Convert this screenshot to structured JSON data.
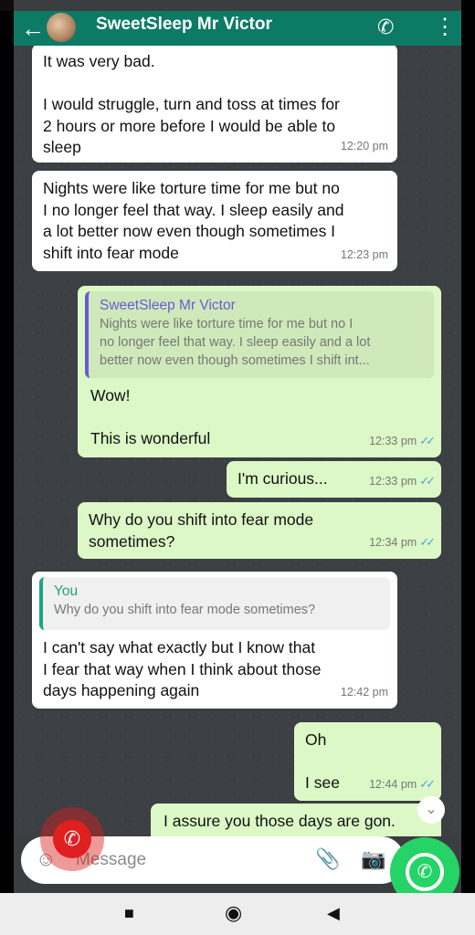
{
  "header": {
    "contact_name": "SweetSleep Mr Victor",
    "back_icon": "←",
    "add_call_icon": "✆"
  },
  "messages": [
    {
      "text": "It was very bad.\n\nI would struggle, turn and toss at times for\n2 hours or more before I would be able to\nsleep",
      "time": "12:20 pm"
    },
    {
      "text": "Nights were like torture time for me but no\nI no longer feel that way. I sleep easily and\na lot better now even though sometimes I\nshift into fear mode",
      "time": "12:23 pm"
    },
    {
      "quote_name": "SweetSleep Mr Victor",
      "quote_text": "Nights were like torture time for me but no I\nno longer feel that way. I sleep easily and a lot\nbetter now even though sometimes I shift int...",
      "text": "Wow!\n\nThis is wonderful",
      "time": "12:33 pm",
      "ticks": "✓✓"
    },
    {
      "text": "I'm curious...",
      "time": "12:33 pm",
      "ticks": "✓✓"
    },
    {
      "text": "Why do you shift into fear mode\nsometimes?",
      "time": "12:34 pm",
      "ticks": "✓✓"
    },
    {
      "quote_name": "You",
      "quote_text": "Why do you shift into fear mode sometimes?",
      "text": "I can't say what exactly but I know that\nI fear that way when I think about those\ndays happening again",
      "time": "12:42 pm"
    },
    {
      "text": "Oh\n\nI see",
      "time": "12:44 pm",
      "ticks": "✓✓"
    },
    {
      "text": "I assure you those days are gon."
    }
  ],
  "input": {
    "placeholder": "Message"
  },
  "icons": {
    "emoji": "☺",
    "attach": "📎",
    "camera": "📷",
    "scroll_down": "⌄",
    "phone": "✆",
    "whatsapp": "✆"
  },
  "nav": {
    "recents": "■",
    "home": "◉",
    "back": "◀"
  },
  "colors": {
    "header": "#0d7a66",
    "outgoing": "#dcf8c6",
    "incoming": "#ffffff",
    "whatsapp": "#25d366",
    "call": "#e02020"
  }
}
